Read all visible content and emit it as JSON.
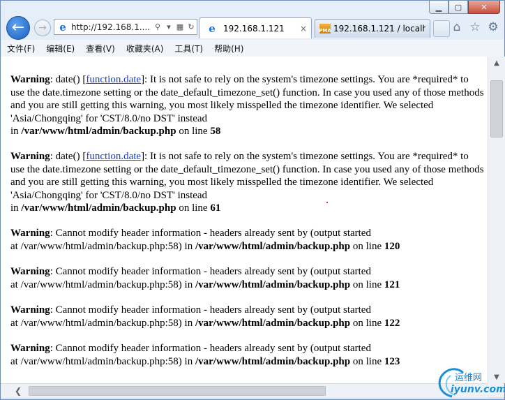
{
  "browser": {
    "address_bar": {
      "url": "http://192.168.1...."
    },
    "tabs": [
      {
        "label": "192.168.1.121",
        "close": "×",
        "active": true
      },
      {
        "label": "192.168.1.121 / localh...",
        "active": false
      }
    ],
    "pma_badge": "PMA",
    "menu": [
      "文件(F)",
      "编辑(E)",
      "查看(V)",
      "收藏夹(A)",
      "工具(T)",
      "帮助(H)"
    ],
    "icons": [
      "back-icon",
      "forward-icon",
      "ie-logo-icon",
      "search-icon",
      "compat-view-icon",
      "refresh-icon",
      "home-icon",
      "favorites-star-icon",
      "settings-gear-icon",
      "phpmyadmin-icon"
    ]
  },
  "content": {
    "date_warnings": [
      {
        "label": "Warning",
        "pre": ": date() [",
        "link": "function.date",
        "text": "]: It is not safe to rely on the system's timezone settings. You are *required* to use the date.timezone setting or the date_default_timezone_set() function. In case you used any of those methods and you are still getting this warning, you most likely misspelled the timezone identifier. We selected 'Asia/Chongqing' for 'CST/8.0/no DST' instead",
        "in": "in ",
        "file": "/var/www/html/admin/backup.php",
        "on_line": " on line ",
        "line": "58"
      },
      {
        "label": "Warning",
        "pre": ": date() [",
        "link": "function.date",
        "text": "]: It is not safe to rely on the system's timezone settings. You are *required* to use the date.timezone setting or the date_default_timezone_set() function. In case you used any of those methods and you are still getting this warning, you most likely misspelled the timezone identifier. We selected 'Asia/Chongqing' for 'CST/8.0/no DST' instead",
        "in": "in ",
        "file": "/var/www/html/admin/backup.php",
        "on_line": " on line ",
        "line": "61"
      }
    ],
    "header_warnings": [
      {
        "label": "Warning",
        "text": ": Cannot modify header information - headers already sent by (output started",
        "at": "at /var/www/html/admin/backup.php:58) in ",
        "file": "/var/www/html/admin/backup.php",
        "on_line": " on line ",
        "line": "120"
      },
      {
        "label": "Warning",
        "text": ": Cannot modify header information - headers already sent by (output started",
        "at": "at /var/www/html/admin/backup.php:58) in ",
        "file": "/var/www/html/admin/backup.php",
        "on_line": " on line ",
        "line": "121"
      },
      {
        "label": "Warning",
        "text": ": Cannot modify header information - headers already sent by (output started",
        "at": "at /var/www/html/admin/backup.php:58) in ",
        "file": "/var/www/html/admin/backup.php",
        "on_line": " on line ",
        "line": "122"
      },
      {
        "label": "Warning",
        "text": ": Cannot modify header information - headers already sent by (output started",
        "at": "at /var/www/html/admin/backup.php:58) in ",
        "file": "/var/www/html/admin/backup.php",
        "on_line": " on line ",
        "line": "123"
      }
    ]
  },
  "watermark": {
    "cn": "运维网",
    "domain": "iyunv.com"
  }
}
